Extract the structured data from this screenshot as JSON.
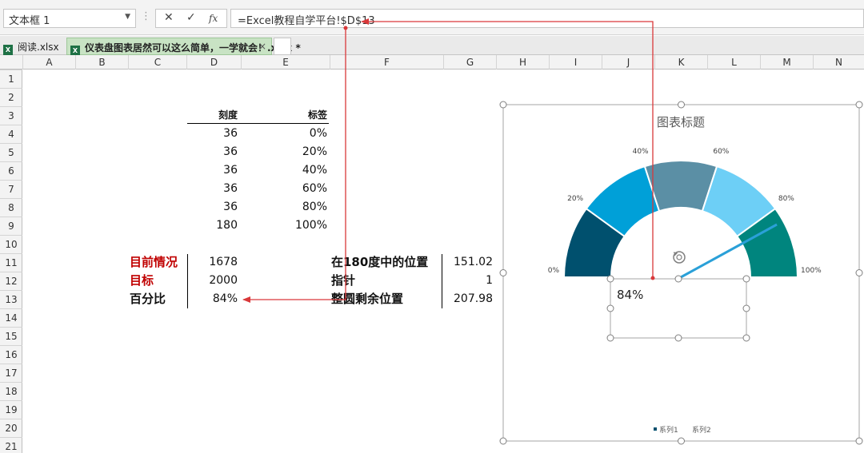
{
  "formula_bar": {
    "name_box": "文本框 1",
    "dropdown_icon": "chevron-down-icon",
    "separator": "⋮",
    "cancel_glyph": "✕",
    "enter_glyph": "✓",
    "fx_glyph": "fx",
    "formula": "=Excel教程自学平台!$D$13"
  },
  "workbook_tabs": {
    "tab1": "阅读.xlsx",
    "tab2": "仪表盘图表居然可以这么简单，一学就会！.xlsx *",
    "excel_icon_glyph": "X",
    "close_glyph": "×"
  },
  "columns": [
    "A",
    "B",
    "C",
    "D",
    "E",
    "F",
    "G",
    "H",
    "I",
    "J",
    "K",
    "L",
    "M",
    "N"
  ],
  "rows": [
    "1",
    "2",
    "3",
    "4",
    "5",
    "6",
    "7",
    "8",
    "9",
    "10",
    "11",
    "12",
    "13",
    "14",
    "15",
    "16",
    "17",
    "18",
    "19",
    "20",
    "21"
  ],
  "table": {
    "header_scale": "刻度",
    "header_label": "标签",
    "rows": [
      {
        "scale": "36",
        "label": "0%"
      },
      {
        "scale": "36",
        "label": "20%"
      },
      {
        "scale": "36",
        "label": "40%"
      },
      {
        "scale": "36",
        "label": "60%"
      },
      {
        "scale": "36",
        "label": "80%"
      },
      {
        "scale": "180",
        "label": "100%"
      }
    ]
  },
  "summary": {
    "current_label": "目前情况",
    "current_value": "1678",
    "target_label": "目标",
    "target_value": "2000",
    "percent_label": "百分比",
    "percent_value": "84%",
    "pos180_label": "在180度中的位置",
    "pos180_value": "151.02",
    "pointer_label": "指针",
    "pointer_value": "1",
    "remaining_label": "整圆剩余位置",
    "remaining_value": "207.98"
  },
  "colors": {
    "grid_header_bg": "#f3f3f3",
    "active_tab": "#c8e3c4",
    "accent_red": "#c00000",
    "arrow_red": "#d9383a",
    "pointer": "#2aa0d8"
  },
  "chart_data": {
    "type": "doughnut-gauge",
    "title": "图表标题",
    "segments": [
      {
        "label": "0%-20%",
        "value": 36,
        "color": "#00506e"
      },
      {
        "label": "20%-40%",
        "value": 36,
        "color": "#00a0d8"
      },
      {
        "label": "40%-60%",
        "value": 36,
        "color": "#5b8fa5"
      },
      {
        "label": "60%-80%",
        "value": 36,
        "color": "#6dcff6"
      },
      {
        "label": "80%-100%",
        "value": 36,
        "color": "#00857e"
      }
    ],
    "tick_labels": [
      "0%",
      "20%",
      "40%",
      "60%",
      "80%",
      "100%"
    ],
    "pointer_percent": 84,
    "textbox_value": "84%",
    "legend": [
      "系列1",
      "系列2"
    ],
    "legend_placement": "bottom"
  }
}
